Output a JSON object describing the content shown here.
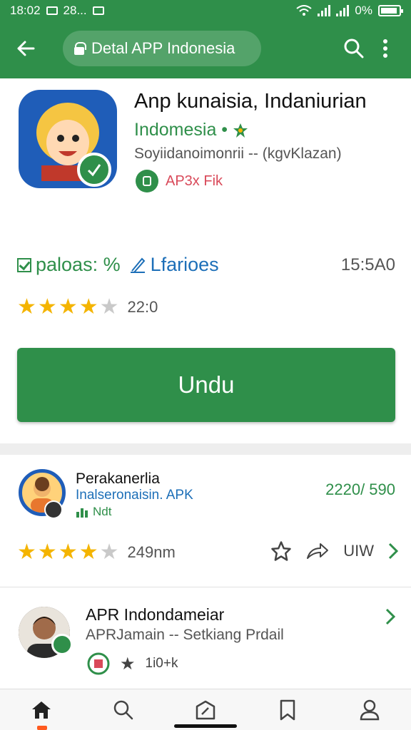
{
  "status_bar": {
    "time": "18:02",
    "left_extra": "28...",
    "battery_pct": "0%"
  },
  "app_bar": {
    "url_title": "Detal APP Indonesia"
  },
  "app": {
    "title": "Anp kunaisia, Indaniurian",
    "developer": "Indomesia •",
    "subtitle": "Soyiidanoimonrii -- (kgvKlazan)",
    "tag": "AP3x Fik",
    "meta_a": "paloas: %",
    "meta_b": "Lfarioes",
    "size": "15:5A0",
    "rating_stars": 4,
    "rating_count": "22:0",
    "download_label": "Undu"
  },
  "list": [
    {
      "title": "Perakanerlia",
      "subtitle": "Inalseronaisin. APK",
      "note": "Ndt",
      "version": "2220/ 590",
      "rating_stars": 4,
      "rating_count": "249nm",
      "action_label": "UIW"
    },
    {
      "title": "APR Indondameiar",
      "subtitle": "APRJamain -- Setkiang Prdail",
      "tag_text": "1i0+k"
    }
  ],
  "colors": {
    "brand_green": "#2f8f4a",
    "link_blue": "#1d6fb8",
    "star_gold": "#f4b400",
    "tag_red": "#d94a5a"
  },
  "icons": [
    "back-arrow-icon",
    "lock-icon",
    "search-icon",
    "more-vert-icon",
    "star-icon",
    "share-icon",
    "chevron-right-icon",
    "home-icon",
    "explore-icon",
    "bookmark-icon",
    "profile-icon"
  ]
}
